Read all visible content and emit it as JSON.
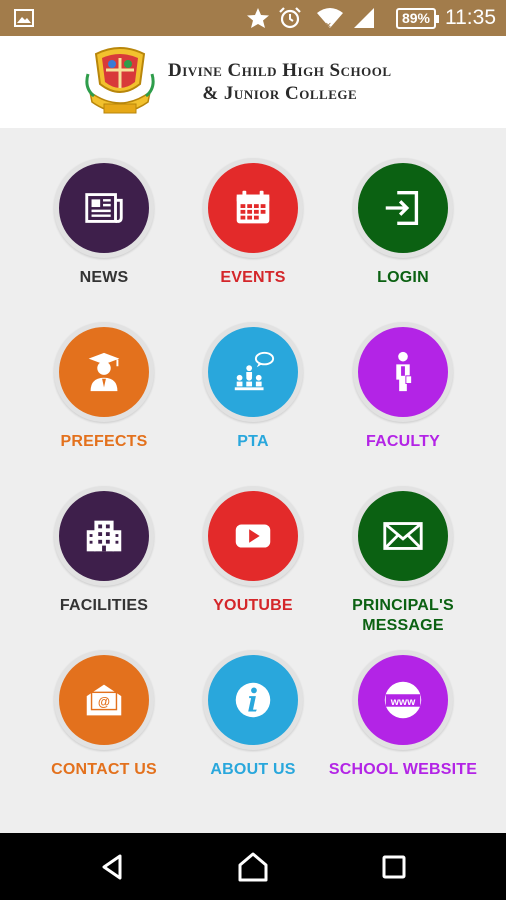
{
  "status_bar": {
    "time": "11:35",
    "battery": "89%",
    "icons": [
      "image-icon",
      "star-icon",
      "alarm-icon",
      "wifi-icon",
      "signal-icon",
      "battery-icon"
    ],
    "background": "#a27c4b"
  },
  "header": {
    "school_line1": "Divine Child High School",
    "school_line2": "& Junior College"
  },
  "menu": [
    {
      "label": "NEWS",
      "icon": "newspaper-icon",
      "color": "#3e1f4b",
      "text_color": "#333333"
    },
    {
      "label": "EVENTS",
      "icon": "calendar-icon",
      "color": "#e32a2a",
      "text_color": "#d4262a"
    },
    {
      "label": "LOGIN",
      "icon": "login-icon",
      "color": "#0b6112",
      "text_color": "#0b6112"
    },
    {
      "label": "PREFECTS",
      "icon": "graduate-icon",
      "color": "#e3711d",
      "text_color": "#e3711d"
    },
    {
      "label": "PTA",
      "icon": "meeting-icon",
      "color": "#29a7dc",
      "text_color": "#29a7dc"
    },
    {
      "label": "FACULTY",
      "icon": "person-icon",
      "color": "#b324e6",
      "text_color": "#b324e6"
    },
    {
      "label": "FACILITIES",
      "icon": "building-icon",
      "color": "#3e1f4b",
      "text_color": "#333333"
    },
    {
      "label": "YOUTUBE",
      "icon": "play-icon",
      "color": "#e32a2a",
      "text_color": "#d4262a"
    },
    {
      "label": "PRINCIPAL'S\nMESSAGE",
      "icon": "envelope-icon",
      "color": "#0b6112",
      "text_color": "#0b6112"
    },
    {
      "label": "CONTACT US",
      "icon": "mail-icon",
      "color": "#e3711d",
      "text_color": "#e3711d"
    },
    {
      "label": "ABOUT US",
      "icon": "info-icon",
      "color": "#29a7dc",
      "text_color": "#29a7dc"
    },
    {
      "label": "SCHOOL WEBSITE",
      "icon": "www-icon",
      "color": "#b324e6",
      "text_color": "#b324e6"
    }
  ],
  "nav_bar": {
    "buttons": [
      "back-icon",
      "home-icon",
      "recents-icon"
    ]
  }
}
